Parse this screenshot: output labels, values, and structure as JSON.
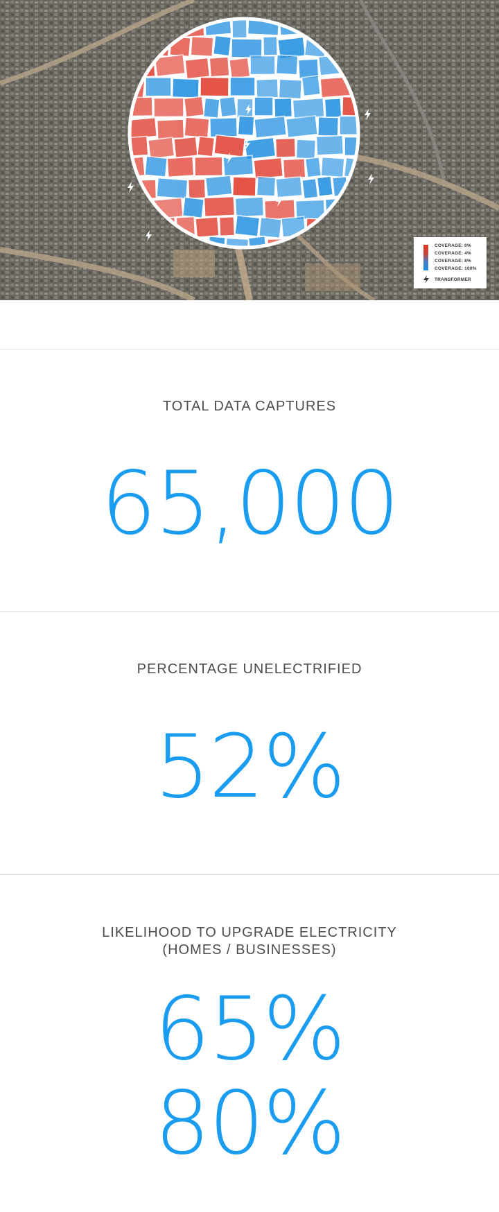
{
  "hero": {
    "legend": {
      "items": [
        "COVERAGE: 0%",
        "COVERAGE: 4%",
        "COVERAGE: 8%",
        "COVERAGE: 100%"
      ],
      "transformer_label": "TRANSFORMER"
    },
    "colors": {
      "no_coverage": "#e0392b",
      "full_coverage": "#1f8ee0",
      "transformer_icon": "#ffffff"
    }
  },
  "stats": [
    {
      "label": "TOTAL DATA CAPTURES",
      "values": [
        "65,000"
      ]
    },
    {
      "label": "PERCENTAGE UNELECTRIFIED",
      "values": [
        "52%"
      ]
    },
    {
      "label_line1": "LIKELIHOOD TO UPGRADE ELECTRICITY",
      "label_line2": "(HOMES / BUSINESSES)",
      "values": [
        "65%",
        "80%"
      ]
    }
  ],
  "accent_color": "#1a9cf0"
}
